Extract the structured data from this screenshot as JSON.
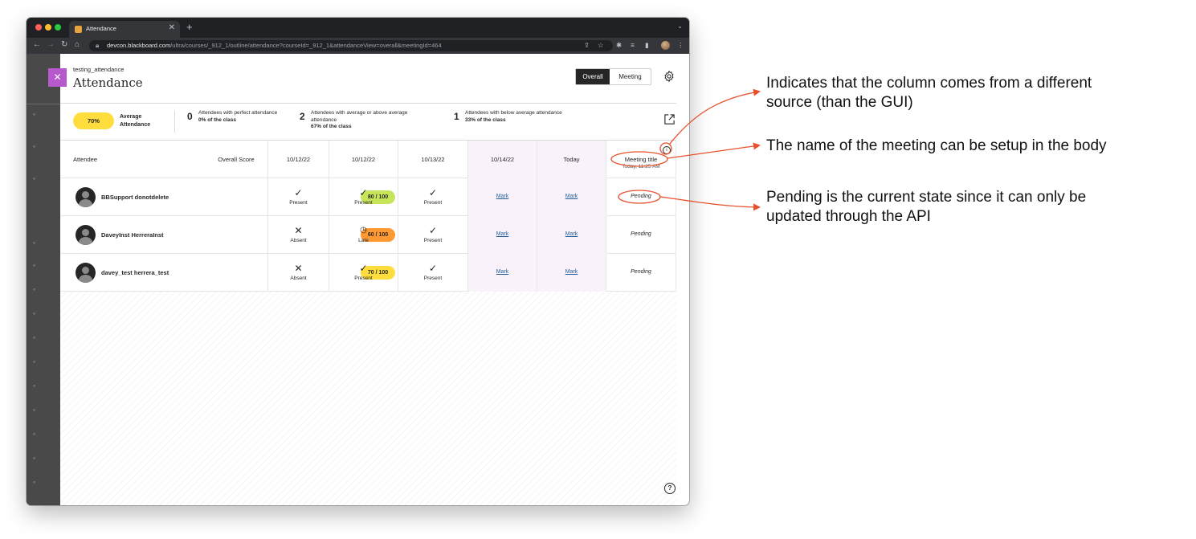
{
  "browser": {
    "tab_title": "Attendance",
    "tab_close": "✕",
    "new_tab": "+",
    "url_host": "devcon.blackboard.com",
    "url_path": "/ultra/courses/_912_1/outline/attendance?courseId=_912_1&attendanceView=overall&meetingId=464",
    "icons": [
      "back-icon",
      "forward-icon",
      "reload-icon",
      "home-icon",
      "share-icon",
      "star-icon",
      "extensions-icon",
      "reading-list-icon",
      "sidebar-icon",
      "profile-avatar",
      "menu-icon"
    ]
  },
  "panel": {
    "close_glyph": "✕",
    "course_name": "testing_attendance",
    "title": "Attendance",
    "view_toggle": {
      "overall": "Overall",
      "meeting": "Meeting"
    }
  },
  "summary": {
    "average_pill": "70%",
    "average_label": "Average Attendance",
    "stats": [
      {
        "count": "0",
        "text": "Attendees with perfect attendance",
        "pct": "0% of the class"
      },
      {
        "count": "2",
        "text": "Attendees with average or above average attendance",
        "pct": "67% of the class"
      },
      {
        "count": "1",
        "text": "Attendees with below average attendance",
        "pct": "33% of the class"
      }
    ]
  },
  "table": {
    "headers": {
      "attendee": "Attendee",
      "score": "Overall Score",
      "dates": [
        "10/12/22",
        "10/12/22",
        "10/13/22",
        "10/14/22",
        "Today"
      ],
      "meeting_title": "Meeting title",
      "meeting_time": "Today, 11:25 AM",
      "info_glyph": "i"
    },
    "rows": [
      {
        "name": "BBSupport donotdelete",
        "score": "80 / 100",
        "score_color": "#c7e55b",
        "marks": [
          {
            "sym": "✓",
            "label": "Present"
          },
          {
            "sym": "✓",
            "label": "Present"
          },
          {
            "sym": "✓",
            "label": "Present"
          }
        ],
        "links": [
          "Mark",
          "Mark"
        ],
        "status": "Pending"
      },
      {
        "name": "DaveyInst HerreraInst",
        "score": "60 / 100",
        "score_color": "#ff9933",
        "marks": [
          {
            "sym": "✕",
            "label": "Absent"
          },
          {
            "sym": "◷",
            "label": "Late"
          },
          {
            "sym": "✓",
            "label": "Present"
          }
        ],
        "links": [
          "Mark",
          "Mark"
        ],
        "status": "Pending"
      },
      {
        "name": "davey_test herrera_test",
        "score": "70 / 100",
        "score_color": "#ffdd3c",
        "marks": [
          {
            "sym": "✕",
            "label": "Absent"
          },
          {
            "sym": "✓",
            "label": "Present"
          },
          {
            "sym": "✓",
            "label": "Present"
          }
        ],
        "links": [
          "Mark",
          "Mark"
        ],
        "status": "Pending"
      }
    ]
  },
  "help_glyph": "?",
  "annotations": {
    "colors": {
      "arrow": "#e8502a"
    },
    "notes": [
      {
        "line1": "Indicates that the column comes from a different",
        "line2": "source (than the GUI)"
      },
      {
        "line1": "The name of the meeting can be setup in the body",
        "line2": ""
      },
      {
        "line1": "Pending is the current state since it can only be",
        "line2": "updated through the API"
      }
    ]
  }
}
